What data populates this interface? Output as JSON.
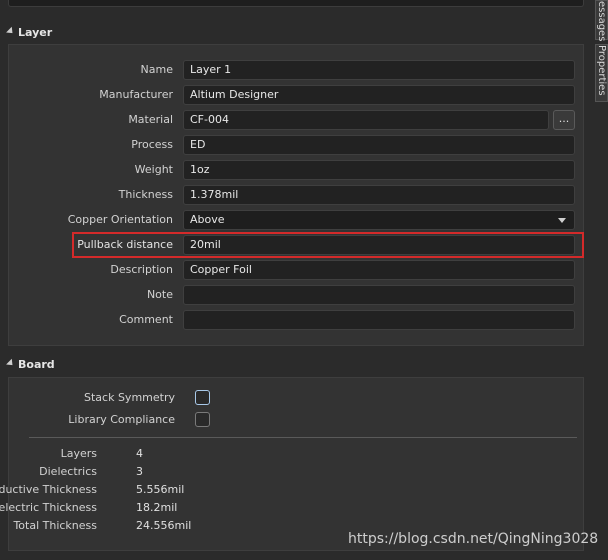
{
  "layer_section": {
    "title": "Layer"
  },
  "layer_fields": [
    {
      "label": "Name",
      "value": "Layer 1"
    },
    {
      "label": "Manufacturer",
      "value": "Altium Designer"
    },
    {
      "label": "Material",
      "value": "CF-004"
    },
    {
      "label": "Process",
      "value": "ED"
    },
    {
      "label": "Weight",
      "value": "1oz"
    },
    {
      "label": "Thickness",
      "value": "1.378mil"
    },
    {
      "label": "Copper Orientation",
      "value": "Above"
    },
    {
      "label": "Pullback distance",
      "value": "20mil"
    },
    {
      "label": "Description",
      "value": "Copper Foil"
    },
    {
      "label": "Note",
      "value": ""
    },
    {
      "label": "Comment",
      "value": ""
    }
  ],
  "material_button": "...",
  "board_section": {
    "title": "Board",
    "stack_symmetry": "Stack Symmetry",
    "library_compliance": "Library Compliance",
    "stats": [
      {
        "label": "Layers",
        "value": "4"
      },
      {
        "label": "Dielectrics",
        "value": "3"
      },
      {
        "label": "Conductive Thickness",
        "value": "5.556mil"
      },
      {
        "label": "Dielectric Thickness",
        "value": "18.2mil"
      },
      {
        "label": "Total Thickness",
        "value": "24.556mil"
      }
    ]
  },
  "side_tabs": [
    "essages",
    "Properties"
  ],
  "watermark": "https://blog.csdn.net/QingNing3028",
  "accent_color": "#d42a2a"
}
